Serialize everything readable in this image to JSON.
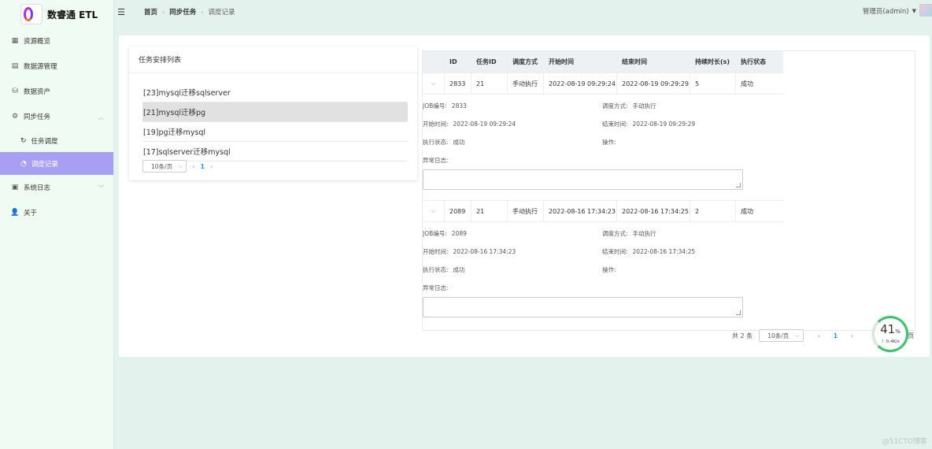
{
  "app": {
    "logo_text": "数睿通 ETL",
    "logo_small_text": "数睿通\nETL"
  },
  "sidebar": {
    "items": [
      {
        "label": "资源概览",
        "icon": "grid-icon"
      },
      {
        "label": "数据源管理",
        "icon": "database-icon"
      },
      {
        "label": "数据资产",
        "icon": "storage-icon"
      },
      {
        "label": "同步任务",
        "icon": "gear-icon",
        "expanded": true
      },
      {
        "label": "系统日志",
        "icon": "log-icon"
      },
      {
        "label": "关于",
        "icon": "user-icon"
      }
    ],
    "sub_items": [
      {
        "label": "任务调度",
        "icon": "refresh-icon"
      },
      {
        "label": "调度记录",
        "icon": "clock-icon",
        "active": true
      }
    ]
  },
  "header": {
    "breadcrumb": [
      "首页",
      "同步任务",
      "调度记录"
    ],
    "user": "管理员(admin)"
  },
  "left_panel": {
    "title": "任务安排列表",
    "tasks": [
      "[23]mysql迁移sqlserver",
      "[21]mysql迁移pg",
      "[19]pg迁移mysql",
      "[17]sqlserver迁移mysql"
    ],
    "selected_index": 1,
    "page_size": "10条/页",
    "page": "1"
  },
  "table": {
    "columns": [
      "ID",
      "任务ID",
      "调度方式",
      "开始时间",
      "结束时间",
      "持续时长(s)",
      "执行状态"
    ],
    "rows": [
      {
        "id": "2833",
        "task_id": "21",
        "mode": "手动执行",
        "start": "2022-08-19 09:29:24",
        "end": "2022-08-19 09:29:29",
        "duration": "5",
        "status": "成功"
      },
      {
        "id": "2089",
        "task_id": "21",
        "mode": "手动执行",
        "start": "2022-08-16 17:34:23",
        "end": "2022-08-16 17:34:25",
        "duration": "2",
        "status": "成功"
      }
    ],
    "detail_labels": {
      "job": "JOB编号:",
      "mode": "调度方式:",
      "start": "开始时间:",
      "end": "结束时间:",
      "status": "执行状态:",
      "ops": "操作:",
      "error_log": "异常日志:"
    }
  },
  "pager": {
    "total": "共 2 条",
    "page_size": "10条/页",
    "page": "1",
    "tail": "页"
  },
  "speed_widget": {
    "percent": "41",
    "unit": "%",
    "rate": "0.4K/s"
  },
  "watermark": "@51CTO博客",
  "colors": {
    "accent": "#a89ff2",
    "link": "#1890ff",
    "sidebar_bg": "#f0fbf4",
    "page_bg": "#e3f2ec",
    "widget_green": "#3cc46c"
  }
}
